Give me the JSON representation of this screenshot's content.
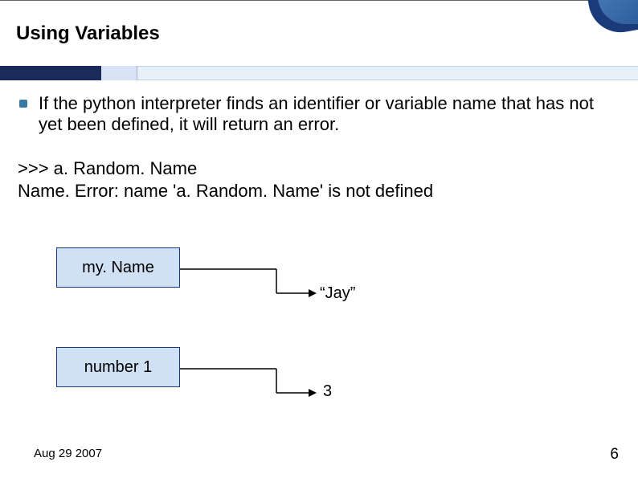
{
  "title": "Using Variables",
  "bullet": "If the python interpreter finds an identifier or variable name that has not yet been defined, it will return an error.",
  "code_line1": ">>> a. Random. Name",
  "code_line2": "Name. Error: name 'a. Random. Name' is not defined",
  "box1_label": "my. Name",
  "box2_label": "number 1",
  "value1": "“Jay”",
  "value2": "3",
  "footer_date": "Aug 29 2007",
  "page_number": "6"
}
